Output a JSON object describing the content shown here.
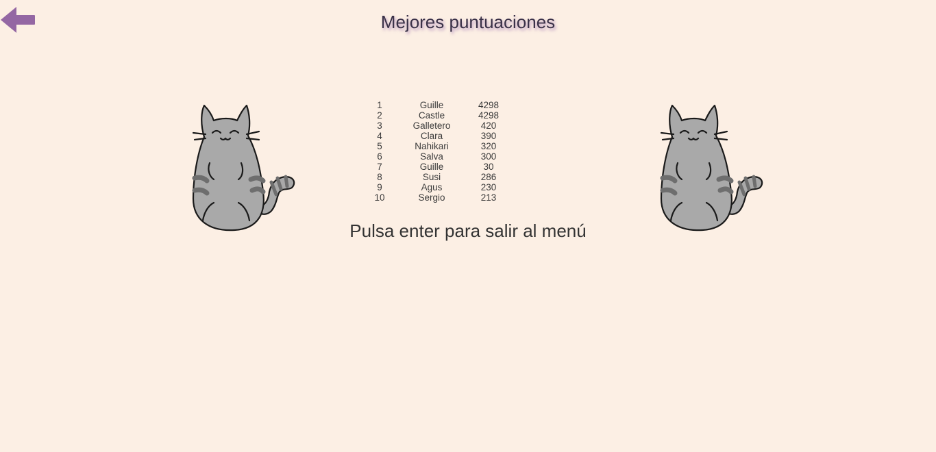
{
  "header": {
    "title": "Mejores puntuaciones",
    "back_icon": "arrow-left-icon"
  },
  "scores": {
    "rows": [
      {
        "rank": "1",
        "name": "Guille",
        "score": "4298"
      },
      {
        "rank": "2",
        "name": "Castle",
        "score": "4298"
      },
      {
        "rank": "3",
        "name": "Galletero",
        "score": "420"
      },
      {
        "rank": "4",
        "name": "Clara",
        "score": "390"
      },
      {
        "rank": "5",
        "name": "Nahikari",
        "score": "320"
      },
      {
        "rank": "6",
        "name": "Salva",
        "score": "300"
      },
      {
        "rank": "7",
        "name": "Guille",
        "score": "30"
      },
      {
        "rank": "8",
        "name": "Susi",
        "score": "286"
      },
      {
        "rank": "9",
        "name": "Agus",
        "score": "230"
      },
      {
        "rank": "10",
        "name": "Sergio",
        "score": "213"
      }
    ]
  },
  "footer": {
    "prompt": "Pulsa enter para salir al menú"
  },
  "colors": {
    "background": "#fcefe4",
    "accent": "#9467a3",
    "cat_body": "#a9a9a9",
    "cat_stripes": "#6e6e6e"
  },
  "decor": {
    "left_icon": "cat-icon",
    "right_icon": "cat-icon"
  }
}
